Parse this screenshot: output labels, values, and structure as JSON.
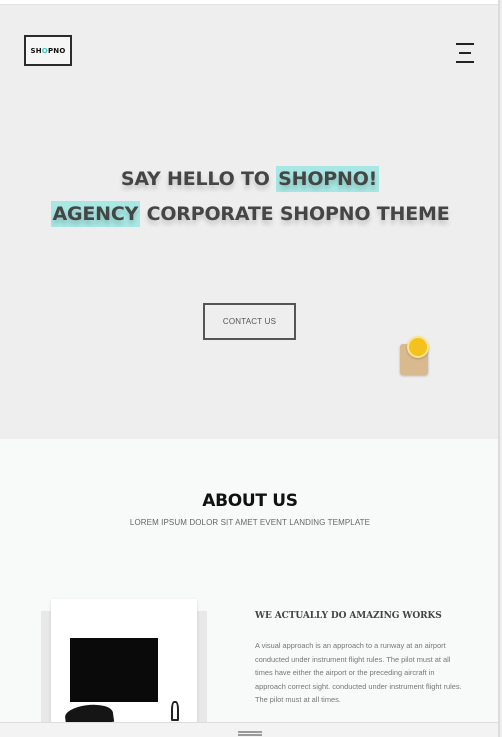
{
  "header": {
    "logo": {
      "part1": "SH",
      "part2": "O",
      "part3": "PNO"
    },
    "menu_icon": "hamburger-menu-icon"
  },
  "hero": {
    "line1_prefix": "SAY HELLO TO ",
    "line1_highlight": "SHOPNO!",
    "line2_highlight": "AGENCY",
    "line2_suffix": " CORPORATE SHOPNO THEME",
    "contact_label": "CONTACT US",
    "highlight_color": "#a8e8e4"
  },
  "floating_widget": {
    "icon": "lightbulb-badge-icon"
  },
  "about": {
    "title": "ABOUT US",
    "subtitle": "LOREM IPSUM DOLOR SIT AMET EVENT LANDING TEMPLATE",
    "works_title": "WE ACTUALLY DO AMAZING WORKS",
    "works_text": "A visual approach is an approach to a runway at an airport conducted under instrument flight rules. The pilot must at all times have either the airport or the preceding aircraft in approach correct sight. conducted under instrument flight rules. The pilot must at all times."
  },
  "bottom": {
    "handle_icon": "drag-handle-icon"
  }
}
